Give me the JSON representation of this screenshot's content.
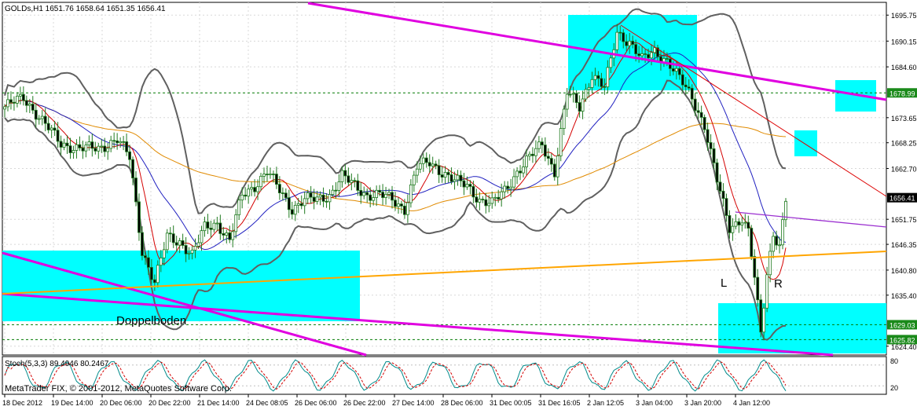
{
  "window": {
    "header": "GOLDs,H1  1651.76 1658.64 1651.35 1656.41",
    "copyright": "MetaTrader FIX, © 2001-2012, MetaQuotes Software Corp."
  },
  "indicator": {
    "label": "Stoch(5,3,3) 89.4946 80.2467",
    "levels": [
      "80",
      "20"
    ]
  },
  "annotations": {
    "double_bottom": "Doppelboden",
    "left_shoulder": "L",
    "right_shoulder": "R"
  },
  "colors": {
    "candle": "#1f7a1f",
    "ma_fast": "#d40000",
    "ma_mid": "#2020c0",
    "ma_slow": "#e08a00",
    "bollinger": "#606060",
    "zone": "#00ffff",
    "trendline_magenta": "#e000e0",
    "trendline_orange": "#ffa500",
    "trendline_red": "#dd0000",
    "trendline_purple": "#9b30d0",
    "level_line": "#007a00",
    "stoch_main": "#008b8b",
    "stoch_signal": "#d40000"
  },
  "chart_data": {
    "type": "candlestick",
    "symbol": "GOLDs",
    "timeframe": "H1",
    "ylim": [
      1622.5,
      1698.5
    ],
    "y_ticks": [
      "1695.75",
      "1690.15",
      "1684.60",
      "1673.65",
      "1668.25",
      "1662.70",
      "1651.75",
      "1646.35",
      "1640.80",
      "1635.40",
      "1624.40"
    ],
    "x_ticks": [
      "18 Dec 2012",
      "19 Dec 14:00",
      "20 Dec 06:00",
      "20 Dec 22:00",
      "21 Dec 14:00",
      "24 Dec 08:05",
      "26 Dec 06:00",
      "26 Dec 22:00",
      "27 Dec 14:00",
      "28 Dec 06:00",
      "31 Dec 00:05",
      "31 Dec 16:05",
      "2 Jan 12:05",
      "3 Jan 04:00",
      "3 Jan 20:00",
      "4 Jan 12:00"
    ],
    "price_tags": [
      {
        "label": "1678.99",
        "value": 1678.99,
        "kind": "level"
      },
      {
        "label": "1656.41",
        "value": 1656.41,
        "kind": "current"
      },
      {
        "label": "1629.03",
        "value": 1629.03,
        "kind": "level"
      },
      {
        "label": "1625.82",
        "value": 1625.82,
        "kind": "level"
      }
    ],
    "close_anchors": [
      [
        0,
        1676
      ],
      [
        6,
        1678
      ],
      [
        12,
        1673
      ],
      [
        18,
        1668
      ],
      [
        24,
        1667
      ],
      [
        30,
        1667
      ],
      [
        36,
        1669
      ],
      [
        40,
        1665
      ],
      [
        44,
        1645
      ],
      [
        48,
        1638
      ],
      [
        52,
        1648
      ],
      [
        56,
        1647
      ],
      [
        60,
        1644
      ],
      [
        64,
        1650
      ],
      [
        68,
        1651
      ],
      [
        72,
        1647
      ],
      [
        76,
        1657
      ],
      [
        80,
        1659
      ],
      [
        84,
        1662
      ],
      [
        88,
        1658
      ],
      [
        92,
        1654
      ],
      [
        96,
        1656
      ],
      [
        100,
        1656
      ],
      [
        104,
        1657
      ],
      [
        108,
        1661
      ],
      [
        112,
        1659
      ],
      [
        116,
        1657
      ],
      [
        120,
        1657
      ],
      [
        124,
        1656
      ],
      [
        128,
        1654
      ],
      [
        132,
        1663
      ],
      [
        136,
        1664
      ],
      [
        140,
        1662
      ],
      [
        144,
        1660
      ],
      [
        148,
        1659
      ],
      [
        152,
        1656
      ],
      [
        156,
        1655
      ],
      [
        160,
        1658
      ],
      [
        164,
        1662
      ],
      [
        168,
        1665
      ],
      [
        172,
        1668
      ],
      [
        176,
        1662
      ],
      [
        180,
        1679
      ],
      [
        184,
        1676
      ],
      [
        188,
        1683
      ],
      [
        192,
        1680
      ],
      [
        196,
        1692
      ],
      [
        200,
        1690
      ],
      [
        204,
        1686
      ],
      [
        208,
        1688
      ],
      [
        212,
        1686
      ],
      [
        216,
        1682
      ],
      [
        220,
        1678
      ],
      [
        224,
        1672
      ],
      [
        228,
        1660
      ],
      [
        232,
        1650
      ],
      [
        236,
        1652
      ],
      [
        238,
        1649
      ],
      [
        240,
        1639
      ],
      [
        242,
        1627
      ],
      [
        244,
        1640
      ],
      [
        246,
        1649
      ],
      [
        248,
        1646
      ],
      [
        250,
        1656
      ]
    ],
    "stochastic": {
      "main": 89.4946,
      "signal": 80.2467,
      "levels": [
        80,
        20
      ]
    }
  }
}
